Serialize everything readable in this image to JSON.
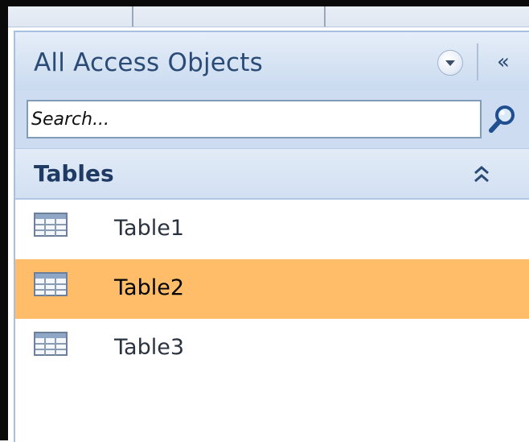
{
  "navigation_pane": {
    "title": "All Access Objects",
    "search": {
      "placeholder": "Search...",
      "value": ""
    },
    "groups": [
      {
        "label": "Tables",
        "expanded": true,
        "items": [
          {
            "label": "Table1",
            "icon": "table-icon",
            "selected": false
          },
          {
            "label": "Table2",
            "icon": "table-icon",
            "selected": true
          },
          {
            "label": "Table3",
            "icon": "table-icon",
            "selected": false
          }
        ]
      }
    ]
  },
  "colors": {
    "selection": "#ffbd69",
    "pane_header": "#d6e3f3",
    "title_text": "#2b4b77",
    "search_border": "#7f9db9"
  }
}
